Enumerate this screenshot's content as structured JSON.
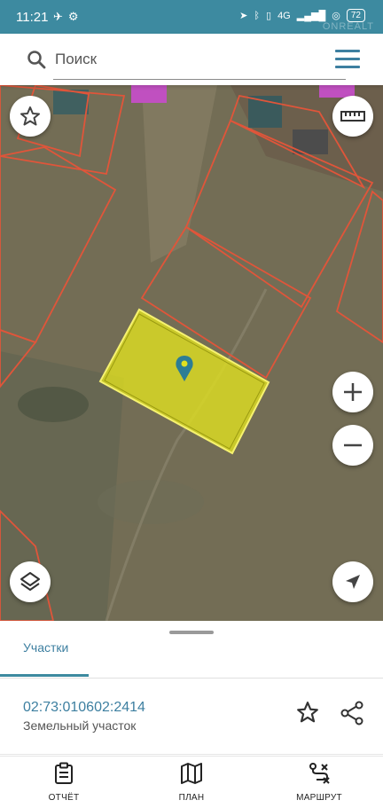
{
  "status_bar": {
    "time": "11:21",
    "network": "4G",
    "battery": "72",
    "watermark": "ONREALT"
  },
  "search": {
    "placeholder": "Поиск"
  },
  "map": {
    "selected_parcel_color": "#e0e020",
    "boundary_color": "#e0553a"
  },
  "panel": {
    "tab_label": "Участки",
    "parcel": {
      "number": "02:73:010602:2414",
      "type": "Земельный участок"
    }
  },
  "bottom_nav": {
    "items": [
      {
        "label": "ОТЧЁТ",
        "icon": "report-icon"
      },
      {
        "label": "ПЛАН",
        "icon": "map-plan-icon"
      },
      {
        "label": "МАРШРУТ",
        "icon": "route-icon"
      }
    ]
  },
  "colors": {
    "accent": "#3d8aa0",
    "link": "#3d7fa0"
  }
}
